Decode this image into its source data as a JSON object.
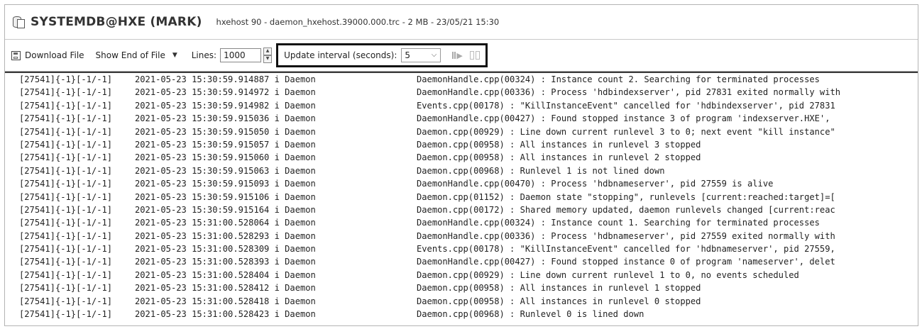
{
  "window": {
    "title": "SYSTEMDB@HXE (MARK)",
    "subtitle": "hxehost 90 - daemon_hxehost.39000.000.trc - 2 MB - 23/05/21 15:30"
  },
  "toolbar": {
    "download_label": "Download File",
    "show_end_label": "Show End of File",
    "lines_label": "Lines:",
    "lines_value": "1000",
    "interval_label": "Update interval (seconds):",
    "interval_value": "5"
  },
  "log_rows": [
    {
      "thread": "[27541]{-1}[-1/-1]",
      "time": "2021-05-23 15:30:59.914887 i Daemon",
      "msg": "DaemonHandle.cpp(00324) : Instance count 2. Searching for terminated processes"
    },
    {
      "thread": "[27541]{-1}[-1/-1]",
      "time": "2021-05-23 15:30:59.914972 i Daemon",
      "msg": "DaemonHandle.cpp(00336) : Process 'hdbindexserver', pid 27831 exited normally with"
    },
    {
      "thread": "[27541]{-1}[-1/-1]",
      "time": "2021-05-23 15:30:59.914982 i Daemon",
      "msg": "Events.cpp(00178) : \"KillInstanceEvent\" cancelled for 'hdbindexserver', pid 27831"
    },
    {
      "thread": "[27541]{-1}[-1/-1]",
      "time": "2021-05-23 15:30:59.915036 i Daemon",
      "msg": "DaemonHandle.cpp(00427) : Found stopped instance 3 of program 'indexserver.HXE', "
    },
    {
      "thread": "[27541]{-1}[-1/-1]",
      "time": "2021-05-23 15:30:59.915050 i Daemon",
      "msg": "Daemon.cpp(00929) : Line down current runlevel 3 to 0; next event \"kill instance\""
    },
    {
      "thread": "[27541]{-1}[-1/-1]",
      "time": "2021-05-23 15:30:59.915057 i Daemon",
      "msg": "Daemon.cpp(00958) : All instances in runlevel 3 stopped"
    },
    {
      "thread": "[27541]{-1}[-1/-1]",
      "time": "2021-05-23 15:30:59.915060 i Daemon",
      "msg": "Daemon.cpp(00958) : All instances in runlevel 2 stopped"
    },
    {
      "thread": "[27541]{-1}[-1/-1]",
      "time": "2021-05-23 15:30:59.915063 i Daemon",
      "msg": "Daemon.cpp(00968) : Runlevel 1 is not lined down"
    },
    {
      "thread": "[27541]{-1}[-1/-1]",
      "time": "2021-05-23 15:30:59.915093 i Daemon",
      "msg": "DaemonHandle.cpp(00470) : Process 'hdbnameserver', pid 27559 is alive"
    },
    {
      "thread": "[27541]{-1}[-1/-1]",
      "time": "2021-05-23 15:30:59.915106 i Daemon",
      "msg": "Daemon.cpp(01152) : Daemon state \"stopping\", runlevels [current:reached:target]=["
    },
    {
      "thread": "[27541]{-1}[-1/-1]",
      "time": "2021-05-23 15:30:59.915164 i Daemon",
      "msg": "Daemon.cpp(00172) : Shared memory updated, daemon runlevels changed [current:reac"
    },
    {
      "thread": "[27541]{-1}[-1/-1]",
      "time": "2021-05-23 15:31:00.528064 i Daemon",
      "msg": "DaemonHandle.cpp(00324) : Instance count 1. Searching for terminated processes"
    },
    {
      "thread": "[27541]{-1}[-1/-1]",
      "time": "2021-05-23 15:31:00.528293 i Daemon",
      "msg": "DaemonHandle.cpp(00336) : Process 'hdbnameserver', pid 27559 exited normally with"
    },
    {
      "thread": "[27541]{-1}[-1/-1]",
      "time": "2021-05-23 15:31:00.528309 i Daemon",
      "msg": "Events.cpp(00178) : \"KillInstanceEvent\" cancelled for 'hdbnameserver', pid 27559,"
    },
    {
      "thread": "[27541]{-1}[-1/-1]",
      "time": "2021-05-23 15:31:00.528393 i Daemon",
      "msg": "DaemonHandle.cpp(00427) : Found stopped instance 0 of program 'nameserver', delet"
    },
    {
      "thread": "[27541]{-1}[-1/-1]",
      "time": "2021-05-23 15:31:00.528404 i Daemon",
      "msg": "Daemon.cpp(00929) : Line down current runlevel 1 to 0, no events scheduled"
    },
    {
      "thread": "[27541]{-1}[-1/-1]",
      "time": "2021-05-23 15:31:00.528412 i Daemon",
      "msg": "Daemon.cpp(00958) : All instances in runlevel 1 stopped"
    },
    {
      "thread": "[27541]{-1}[-1/-1]",
      "time": "2021-05-23 15:31:00.528418 i Daemon",
      "msg": "Daemon.cpp(00958) : All instances in runlevel 0 stopped"
    },
    {
      "thread": "[27541]{-1}[-1/-1]",
      "time": "2021-05-23 15:31:00.528423 i Daemon",
      "msg": "Daemon.cpp(00968) : Runlevel 0 is lined down"
    }
  ]
}
